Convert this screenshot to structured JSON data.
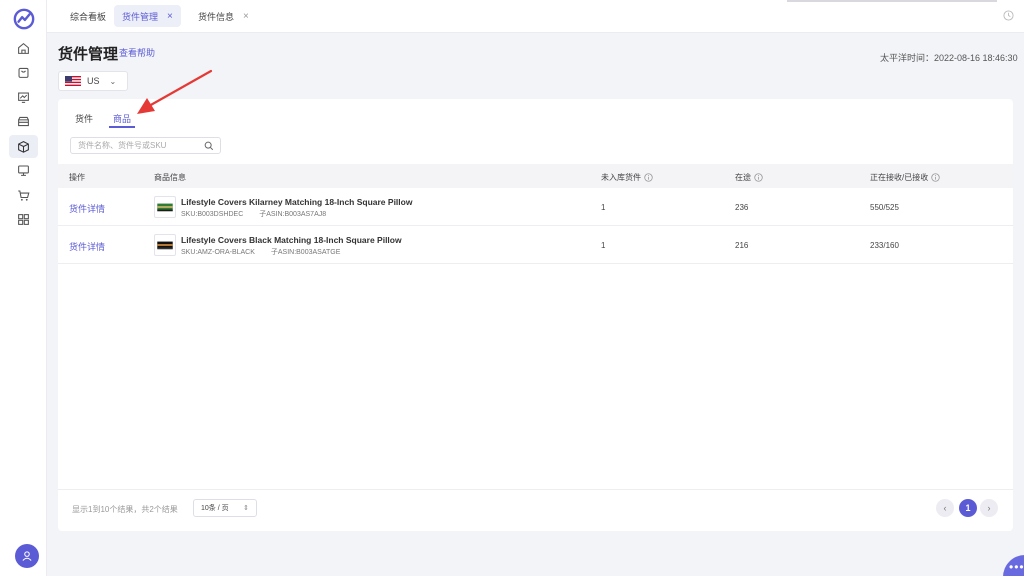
{
  "tabs": [
    {
      "label": "综合看板"
    },
    {
      "label": "货件管理",
      "close": "×"
    },
    {
      "label": "货件信息",
      "close": "×"
    }
  ],
  "page": {
    "title": "货件管理",
    "help_link": "查看帮助",
    "timestamp": "太平洋时间：2022-08-16 18:46:30"
  },
  "country": {
    "label": "US",
    "chevron": "⌄"
  },
  "subtabs": [
    {
      "label": "货件"
    },
    {
      "label": "商品"
    }
  ],
  "search": {
    "placeholder": "货件名称、货件号或SKU",
    "value": ""
  },
  "table": {
    "headers": [
      "操作",
      "商品信息",
      "未入库货件",
      "在途",
      "正在接收/已接收"
    ],
    "rows": [
      {
        "action": "货件详情",
        "name": "Lifestyle Covers Kilarney Matching 18-Inch Square Pillow",
        "sku": "SKU:B003DSHDEC",
        "asin": "子ASIN:B003AS7AJ8",
        "pending": "1",
        "in_transit": "236",
        "receiving": "550/525"
      },
      {
        "action": "货件详情",
        "name": "Lifestyle Covers Black Matching 18-Inch Square Pillow",
        "sku": "SKU:AMZ-ORA-BLACK",
        "asin": "子ASIN:B003ASATGE",
        "pending": "1",
        "in_transit": "216",
        "receiving": "233/160"
      }
    ]
  },
  "pagination": {
    "summary": "显示1到10个结果，共2个结果",
    "page_size": "10条 / 页",
    "current_page": "1",
    "prev": "‹",
    "next": "›"
  },
  "fab": {
    "label": "•••"
  },
  "colors": {
    "accent": "#5b5bd6",
    "arrow": "#e53935"
  }
}
